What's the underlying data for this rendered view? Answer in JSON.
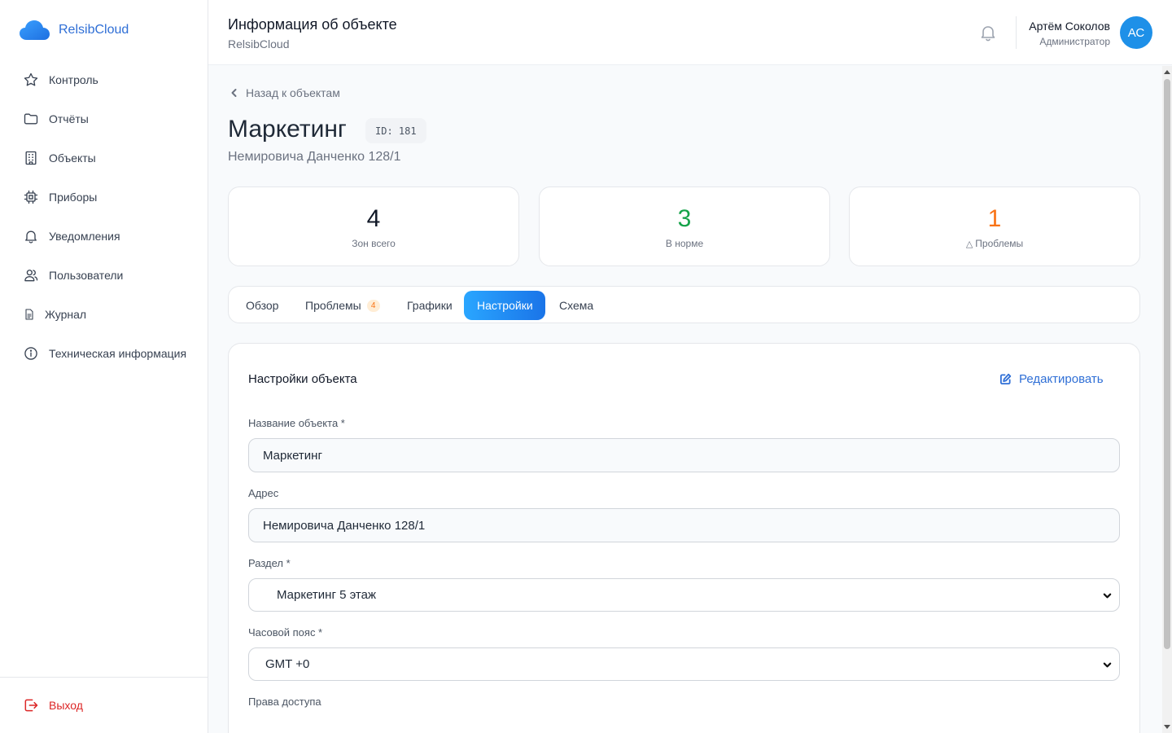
{
  "app": {
    "brand": "RelsibCloud"
  },
  "sidebar": {
    "items": [
      {
        "label": "Контроль",
        "icon": "star-icon"
      },
      {
        "label": "Отчёты",
        "icon": "folder-icon"
      },
      {
        "label": "Объекты",
        "icon": "building-icon"
      },
      {
        "label": "Приборы",
        "icon": "chip-icon"
      },
      {
        "label": "Уведомления",
        "icon": "bell-icon"
      },
      {
        "label": "Пользователи",
        "icon": "users-icon"
      },
      {
        "label": "Журнал",
        "icon": "document-icon"
      },
      {
        "label": "Техническая информация",
        "icon": "info-icon"
      }
    ],
    "logout_label": "Выход"
  },
  "header": {
    "title": "Информация об объекте",
    "subtitle": "RelsibCloud",
    "user_name": "Артём Соколов",
    "user_role": "Администратор",
    "avatar_initials": "АС"
  },
  "object": {
    "back_label": "Назад к объектам",
    "name": "Маркетинг",
    "id_badge": "ID: 181",
    "address": "Немировича Данченко 128/1"
  },
  "stats": [
    {
      "value": "4",
      "label": "Зон всего",
      "color": "#111827"
    },
    {
      "value": "3",
      "label": "В норме",
      "color": "#16a34a"
    },
    {
      "value": "1",
      "label": "Проблемы",
      "color": "#f97316",
      "icon": "warning-icon"
    }
  ],
  "tabs": [
    {
      "label": "Обзор",
      "active": false
    },
    {
      "label": "Проблемы",
      "badge": "4",
      "active": false
    },
    {
      "label": "Графики",
      "active": false
    },
    {
      "label": "Настройки",
      "active": true
    },
    {
      "label": "Схема",
      "active": false
    }
  ],
  "settings": {
    "title": "Настройки объекта",
    "edit_label": "Редактировать",
    "fields": {
      "name": {
        "label": "Название объекта *",
        "value": "Маркетинг"
      },
      "address": {
        "label": "Адрес",
        "value": "Немировича Данченко 128/1"
      },
      "section": {
        "label": "Раздел *",
        "value": "Маркетинг 5 этаж"
      },
      "timezone": {
        "label": "Часовой пояс *",
        "value": "GMT +0"
      },
      "access": {
        "label": "Права доступа"
      }
    }
  },
  "colors": {
    "accent": "#2f6fd6",
    "active_tab": "#1e90e8",
    "danger": "#dc2626",
    "ok": "#16a34a",
    "warn": "#f97316"
  }
}
